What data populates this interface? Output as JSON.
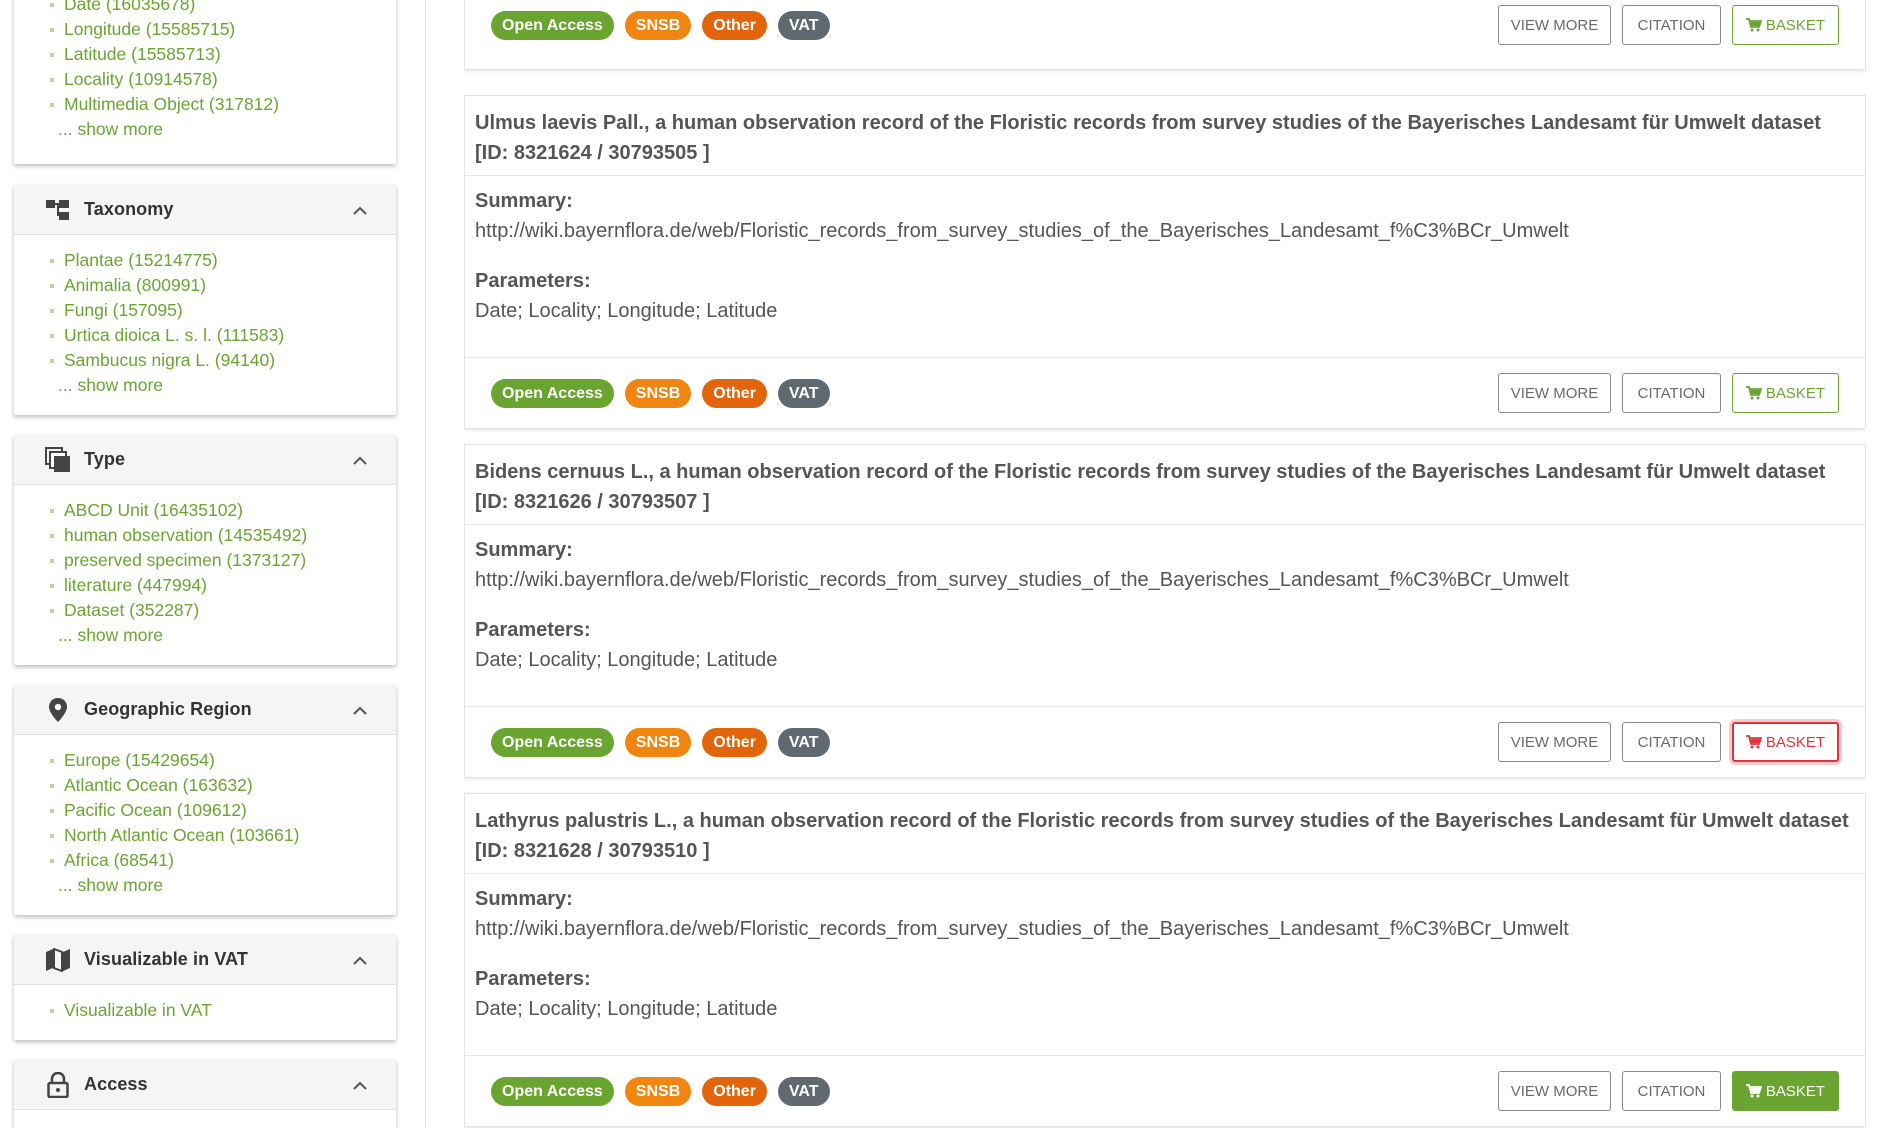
{
  "sidebar": {
    "facet0": {
      "items": [
        "Date (16035678)",
        "Longitude (15585715)",
        "Latitude (15585713)",
        "Locality (10914578)",
        "Multimedia Object (317812)"
      ],
      "show_more": "... show more"
    },
    "taxonomy": {
      "title": "Taxonomy",
      "items": [
        "Plantae (15214775)",
        "Animalia (800991)",
        "Fungi (157095)",
        "Urtica dioica L. s. l. (111583)",
        "Sambucus nigra L. (94140)"
      ],
      "show_more": "... show more"
    },
    "type": {
      "title": "Type",
      "items": [
        "ABCD Unit (16435102)",
        "human observation (14535492)",
        "preserved specimen (1373127)",
        "literature (447994)",
        "Dataset (352287)"
      ],
      "show_more": "... show more"
    },
    "region": {
      "title": "Geographic Region",
      "items": [
        "Europe (15429654)",
        "Atlantic Ocean (163632)",
        "Pacific Ocean (109612)",
        "North Atlantic Ocean (103661)",
        "Africa (68541)"
      ],
      "show_more": "... show more"
    },
    "vat": {
      "title": "Visualizable in VAT",
      "items": [
        "Visualizable in VAT"
      ]
    },
    "access": {
      "title": "Access"
    }
  },
  "labels": {
    "summary": "Summary:",
    "parameters": "Parameters:",
    "view_more": "VIEW MORE",
    "citation": "CITATION",
    "basket": "BASKET"
  },
  "badges": {
    "open": "Open Access",
    "snsb": "SNSB",
    "other": "Other",
    "vat": "VAT"
  },
  "results": [
    {
      "title": "Ulmus laevis Pall., a human observation record of the Floristic records from survey studies of the Bayerisches Landesamt für Umwelt dataset [ID: 8321624 / 30793505 ]",
      "summary": "http://wiki.bayernflora.de/web/Floristic_records_from_survey_studies_of_the_Bayerisches_Landesamt_f%C3%BCr_Umwelt",
      "parameters": "Date; Locality; Longitude; Latitude"
    },
    {
      "title": "Bidens cernuus L., a human observation record of the Floristic records from survey studies of the Bayerisches Landesamt für Umwelt dataset [ID: 8321626 / 30793507 ]",
      "summary": "http://wiki.bayernflora.de/web/Floristic_records_from_survey_studies_of_the_Bayerisches_Landesamt_f%C3%BCr_Umwelt",
      "parameters": "Date; Locality; Longitude; Latitude"
    },
    {
      "title": "Lathyrus palustris L., a human observation record of the Floristic records from survey studies of the Bayerisches Landesamt für Umwelt dataset [ID: 8321628 / 30793510 ]",
      "summary": "http://wiki.bayernflora.de/web/Floristic_records_from_survey_studies_of_the_Bayerisches_Landesamt_f%C3%BCr_Umwelt",
      "parameters": "Date; Locality; Longitude; Latitude"
    }
  ],
  "colors": {
    "accent_green": "#6aa532",
    "snsb_orange": "#f0850f",
    "other_orange": "#e2650c",
    "vat_gray": "#606870",
    "basket_hover_red": "#e0343a"
  }
}
